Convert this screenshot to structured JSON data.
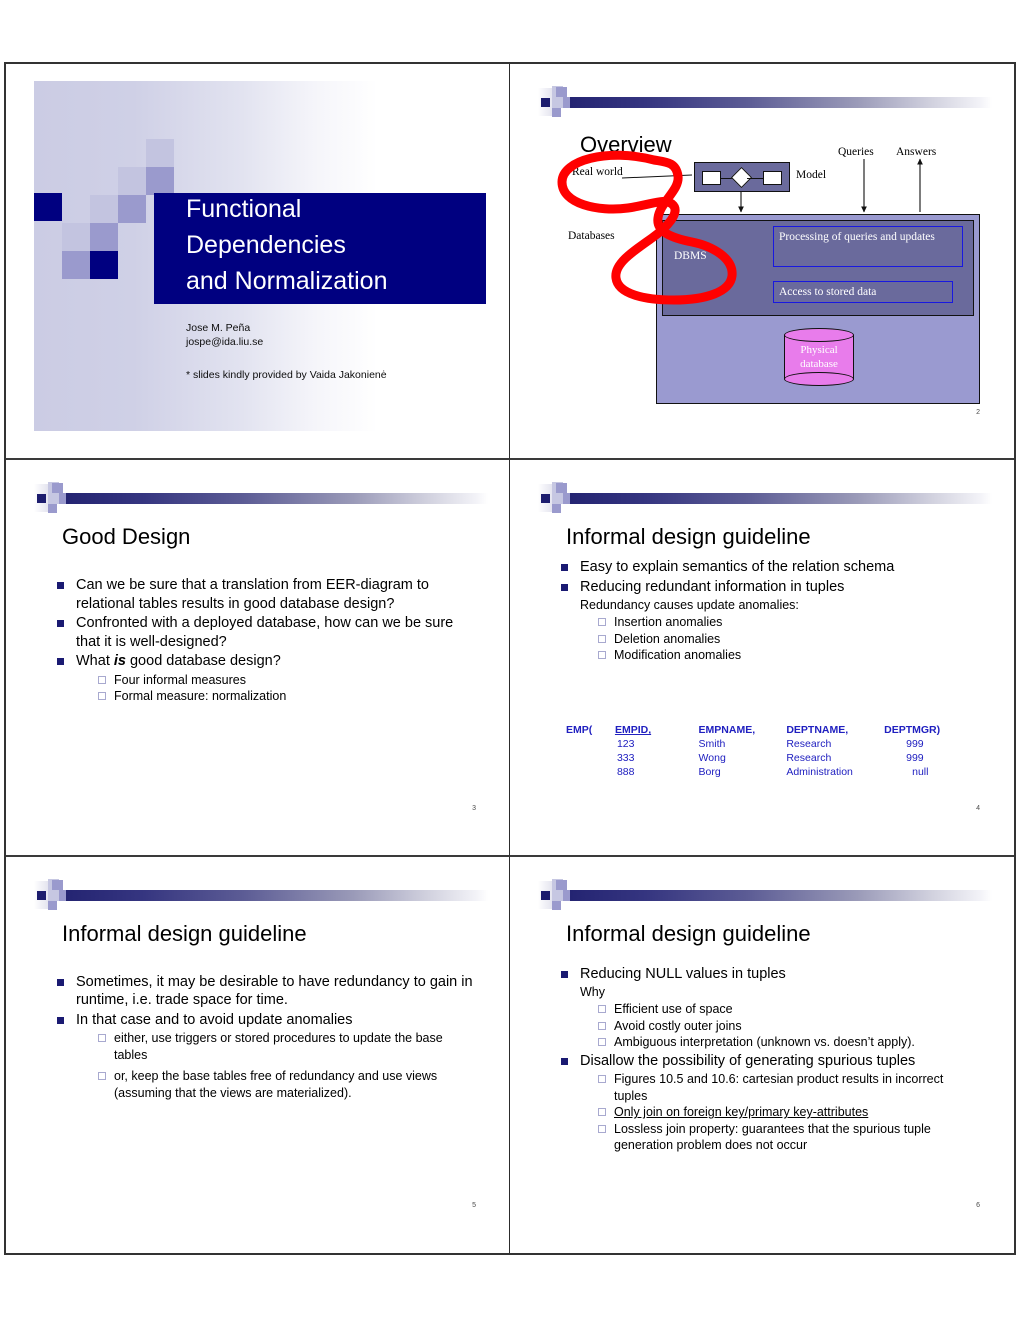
{
  "slide1": {
    "title_lines": [
      "Functional",
      "Dependencies",
      "and Normalization"
    ],
    "author_name": "Jose M. Peña",
    "author_email": "jospe@ida.liu.se",
    "credit": "* slides kindly provided by Vaida Jakonienė"
  },
  "slide2": {
    "title": "Overview",
    "number": "2",
    "labels": {
      "real_world": "Real world",
      "model": "Model",
      "databases": "Databases",
      "queries": "Queries",
      "answers": "Answers",
      "dbms": "DBMS",
      "processing": "Processing of queries and updates",
      "access": "Access to stored data",
      "physical_line1": "Physical",
      "physical_line2": "database"
    },
    "annotation_color": "#ff0000"
  },
  "slide3": {
    "title": "Good Design",
    "number": "3",
    "bullets": [
      "Can we be sure that a translation from EER-diagram to relational tables results in good database design?",
      "Confronted with a deployed database, how can we be sure that it is well-designed?"
    ],
    "bullet3_pre": "What ",
    "bullet3_em": "is",
    "bullet3_post": " good database design?",
    "sub_bullets": [
      "Four informal measures",
      "Formal measure: normalization"
    ]
  },
  "slide4": {
    "title": "Informal design guideline",
    "number": "4",
    "bullets": [
      "Easy to explain semantics of the relation schema",
      "Reducing redundant information in tuples"
    ],
    "plain_note": "Redundancy causes update anomalies:",
    "sub_bullets": [
      "Insertion anomalies",
      "Deletion anomalies",
      "Modification anomalies"
    ],
    "table": {
      "relation_label": "EMP(",
      "columns": [
        "EMPID,",
        "EMPNAME,",
        "DEPTNAME,",
        "DEPTMGR)"
      ],
      "rows": [
        [
          "123",
          "Smith",
          "Research",
          "999"
        ],
        [
          "333",
          "Wong",
          "Research",
          "999"
        ],
        [
          "888",
          "Borg",
          "Administration",
          "null"
        ]
      ],
      "color": "#2020c0"
    }
  },
  "slide5": {
    "title": "Informal design guideline",
    "number": "5",
    "bullets": [
      "Sometimes, it may be desirable to have redundancy to gain in runtime, i.e. trade space for time.",
      "In that case and to avoid update anomalies"
    ],
    "sub_bullets": [
      "either, use triggers or stored procedures to update the base tables",
      "or, keep the base tables free of redundancy and use views (assuming that the views are materialized)."
    ]
  },
  "slide6": {
    "title": "Informal design guideline",
    "number": "6",
    "bullet1": "Reducing NULL values in tuples",
    "plain_note": "Why",
    "sub_bullets_1": [
      "Efficient use of space",
      "Avoid costly outer joins",
      "Ambiguous interpretation (unknown vs. doesn’t apply)."
    ],
    "bullet2": "Disallow the possibility of generating spurious tuples",
    "sub_bullets_2": [
      "Figures 10.5 and 10.6: cartesian product results in incorrect tuples",
      "Only join on foreign key/primary key-attributes",
      "Lossless join property: guarantees that the spurious tuple generation problem does not occur"
    ],
    "underlined_index": 1
  },
  "theme": {
    "navy": "#000080",
    "bullet_navy": "#1a1a72",
    "mid_purple": "#9a9acd",
    "pale_purple": "#c6c7e2"
  }
}
